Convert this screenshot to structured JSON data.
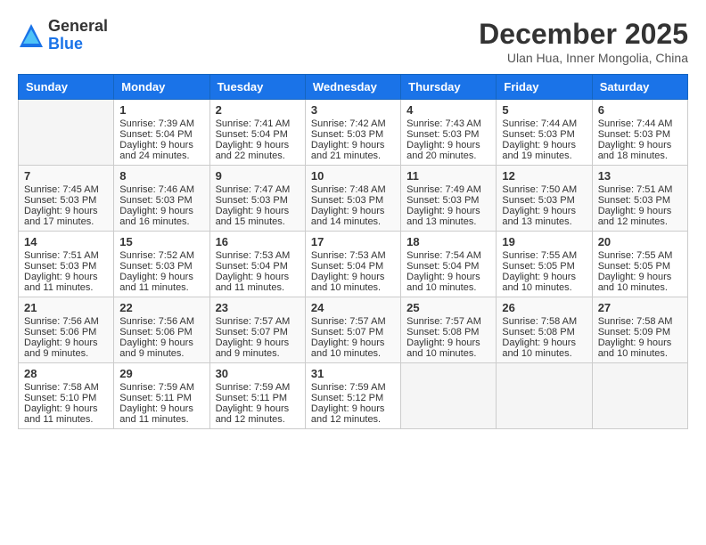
{
  "header": {
    "logo": {
      "general": "General",
      "blue": "Blue"
    },
    "title": "December 2025",
    "location": "Ulan Hua, Inner Mongolia, China"
  },
  "weekdays": [
    "Sunday",
    "Monday",
    "Tuesday",
    "Wednesday",
    "Thursday",
    "Friday",
    "Saturday"
  ],
  "weeks": [
    [
      {
        "day": "",
        "info": ""
      },
      {
        "day": "1",
        "info": "Sunrise: 7:39 AM\nSunset: 5:04 PM\nDaylight: 9 hours\nand 24 minutes."
      },
      {
        "day": "2",
        "info": "Sunrise: 7:41 AM\nSunset: 5:04 PM\nDaylight: 9 hours\nand 22 minutes."
      },
      {
        "day": "3",
        "info": "Sunrise: 7:42 AM\nSunset: 5:03 PM\nDaylight: 9 hours\nand 21 minutes."
      },
      {
        "day": "4",
        "info": "Sunrise: 7:43 AM\nSunset: 5:03 PM\nDaylight: 9 hours\nand 20 minutes."
      },
      {
        "day": "5",
        "info": "Sunrise: 7:44 AM\nSunset: 5:03 PM\nDaylight: 9 hours\nand 19 minutes."
      },
      {
        "day": "6",
        "info": "Sunrise: 7:44 AM\nSunset: 5:03 PM\nDaylight: 9 hours\nand 18 minutes."
      }
    ],
    [
      {
        "day": "7",
        "info": "Sunrise: 7:45 AM\nSunset: 5:03 PM\nDaylight: 9 hours\nand 17 minutes."
      },
      {
        "day": "8",
        "info": "Sunrise: 7:46 AM\nSunset: 5:03 PM\nDaylight: 9 hours\nand 16 minutes."
      },
      {
        "day": "9",
        "info": "Sunrise: 7:47 AM\nSunset: 5:03 PM\nDaylight: 9 hours\nand 15 minutes."
      },
      {
        "day": "10",
        "info": "Sunrise: 7:48 AM\nSunset: 5:03 PM\nDaylight: 9 hours\nand 14 minutes."
      },
      {
        "day": "11",
        "info": "Sunrise: 7:49 AM\nSunset: 5:03 PM\nDaylight: 9 hours\nand 13 minutes."
      },
      {
        "day": "12",
        "info": "Sunrise: 7:50 AM\nSunset: 5:03 PM\nDaylight: 9 hours\nand 13 minutes."
      },
      {
        "day": "13",
        "info": "Sunrise: 7:51 AM\nSunset: 5:03 PM\nDaylight: 9 hours\nand 12 minutes."
      }
    ],
    [
      {
        "day": "14",
        "info": "Sunrise: 7:51 AM\nSunset: 5:03 PM\nDaylight: 9 hours\nand 11 minutes."
      },
      {
        "day": "15",
        "info": "Sunrise: 7:52 AM\nSunset: 5:03 PM\nDaylight: 9 hours\nand 11 minutes."
      },
      {
        "day": "16",
        "info": "Sunrise: 7:53 AM\nSunset: 5:04 PM\nDaylight: 9 hours\nand 11 minutes."
      },
      {
        "day": "17",
        "info": "Sunrise: 7:53 AM\nSunset: 5:04 PM\nDaylight: 9 hours\nand 10 minutes."
      },
      {
        "day": "18",
        "info": "Sunrise: 7:54 AM\nSunset: 5:04 PM\nDaylight: 9 hours\nand 10 minutes."
      },
      {
        "day": "19",
        "info": "Sunrise: 7:55 AM\nSunset: 5:05 PM\nDaylight: 9 hours\nand 10 minutes."
      },
      {
        "day": "20",
        "info": "Sunrise: 7:55 AM\nSunset: 5:05 PM\nDaylight: 9 hours\nand 10 minutes."
      }
    ],
    [
      {
        "day": "21",
        "info": "Sunrise: 7:56 AM\nSunset: 5:06 PM\nDaylight: 9 hours\nand 9 minutes."
      },
      {
        "day": "22",
        "info": "Sunrise: 7:56 AM\nSunset: 5:06 PM\nDaylight: 9 hours\nand 9 minutes."
      },
      {
        "day": "23",
        "info": "Sunrise: 7:57 AM\nSunset: 5:07 PM\nDaylight: 9 hours\nand 9 minutes."
      },
      {
        "day": "24",
        "info": "Sunrise: 7:57 AM\nSunset: 5:07 PM\nDaylight: 9 hours\nand 10 minutes."
      },
      {
        "day": "25",
        "info": "Sunrise: 7:57 AM\nSunset: 5:08 PM\nDaylight: 9 hours\nand 10 minutes."
      },
      {
        "day": "26",
        "info": "Sunrise: 7:58 AM\nSunset: 5:08 PM\nDaylight: 9 hours\nand 10 minutes."
      },
      {
        "day": "27",
        "info": "Sunrise: 7:58 AM\nSunset: 5:09 PM\nDaylight: 9 hours\nand 10 minutes."
      }
    ],
    [
      {
        "day": "28",
        "info": "Sunrise: 7:58 AM\nSunset: 5:10 PM\nDaylight: 9 hours\nand 11 minutes."
      },
      {
        "day": "29",
        "info": "Sunrise: 7:59 AM\nSunset: 5:11 PM\nDaylight: 9 hours\nand 11 minutes."
      },
      {
        "day": "30",
        "info": "Sunrise: 7:59 AM\nSunset: 5:11 PM\nDaylight: 9 hours\nand 12 minutes."
      },
      {
        "day": "31",
        "info": "Sunrise: 7:59 AM\nSunset: 5:12 PM\nDaylight: 9 hours\nand 12 minutes."
      },
      {
        "day": "",
        "info": ""
      },
      {
        "day": "",
        "info": ""
      },
      {
        "day": "",
        "info": ""
      }
    ]
  ]
}
